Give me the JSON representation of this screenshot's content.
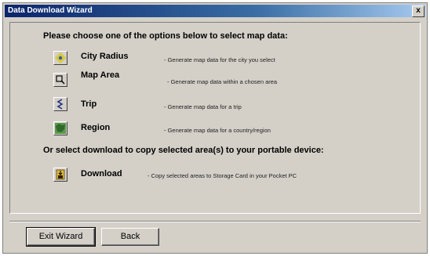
{
  "window": {
    "title": "Data Download Wizard",
    "close_glyph": "x"
  },
  "prompt": "Please choose one of the options below to select map data:",
  "options": [
    {
      "label": "City Radius",
      "description": "- Generate map data for the city you select",
      "icon": "city-radius-icon"
    },
    {
      "label": "Map Area",
      "description": "- Generate map data within a chosen area",
      "icon": "map-area-icon"
    },
    {
      "label": "Trip",
      "description": "- Generate map data for a trip",
      "icon": "trip-icon"
    },
    {
      "label": "Region",
      "description": "- Generate map data for a  country/region",
      "icon": "region-icon"
    }
  ],
  "download_prompt": "Or select download to copy selected area(s) to your portable device:",
  "download": {
    "label": "Download",
    "description": "- Copy selected areas to Storage Card in your Pocket PC",
    "icon": "download-icon"
  },
  "buttons": {
    "exit_label": "Exit Wizard",
    "back_label": "Back"
  }
}
